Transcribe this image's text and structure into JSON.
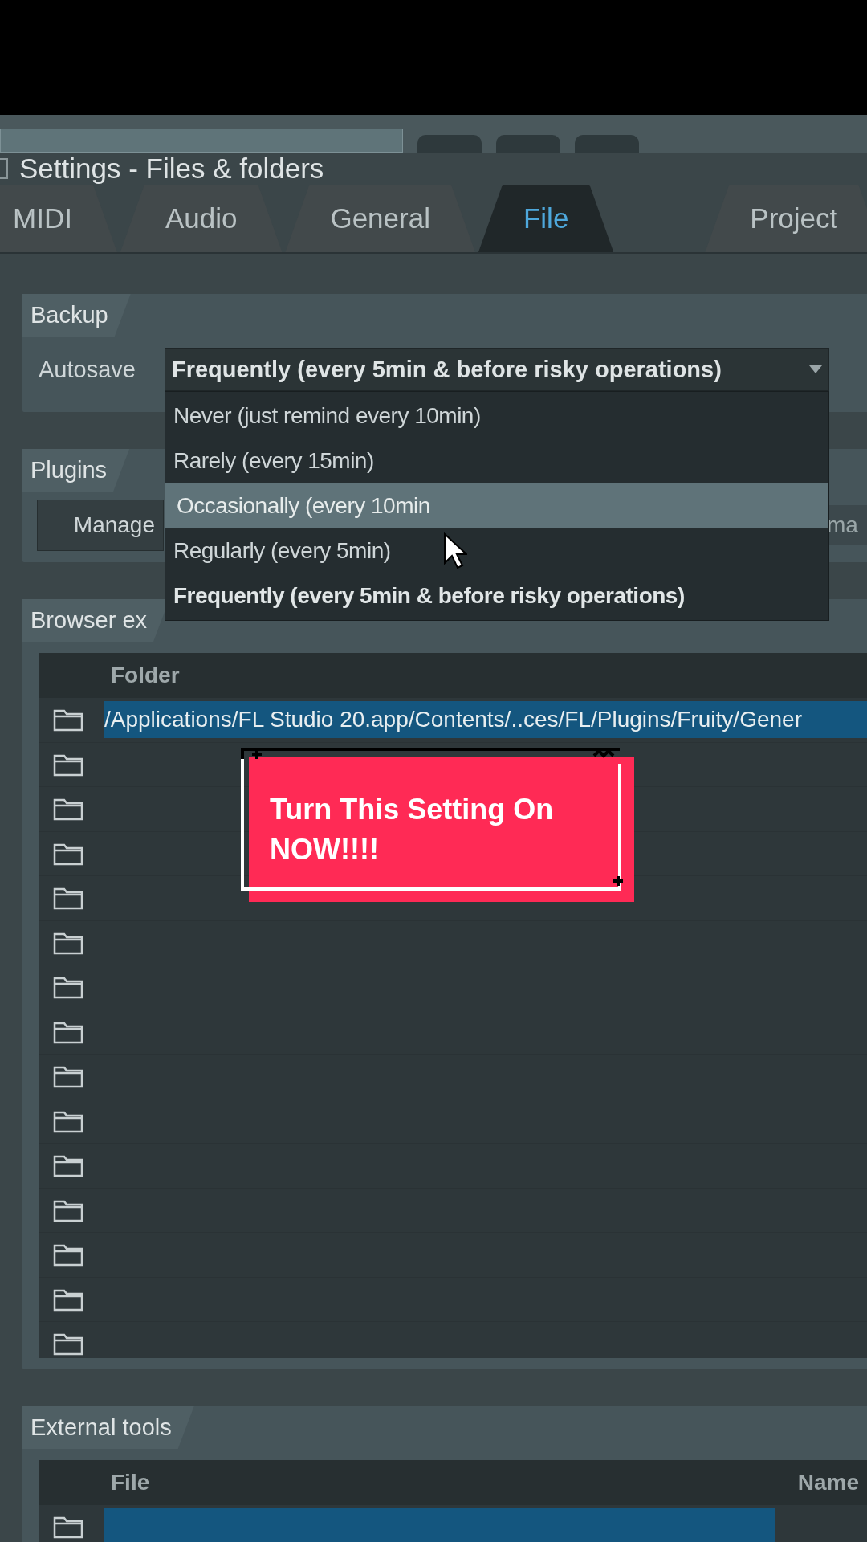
{
  "window": {
    "title": "Settings - Files & folders"
  },
  "tabs": [
    {
      "label": "MIDI",
      "selected": false
    },
    {
      "label": "Audio",
      "selected": false
    },
    {
      "label": "General",
      "selected": false
    },
    {
      "label": "File",
      "selected": true
    },
    {
      "label": "Project",
      "selected": false
    }
  ],
  "backup": {
    "heading": "Backup",
    "autosave": {
      "label": "Autosave",
      "value": "Frequently (every 5min & before risky operations)",
      "expanded": true,
      "options": [
        {
          "label": "Never (just remind every 10min)",
          "selected": false,
          "highlighted": false
        },
        {
          "label": "Rarely (every 15min)",
          "selected": false,
          "highlighted": false
        },
        {
          "label": "Occasionally (every 10min",
          "selected": false,
          "highlighted": true
        },
        {
          "label": "Regularly (every 5min)",
          "selected": false,
          "highlighted": false
        },
        {
          "label": "Frequently (every 5min & before risky operations)",
          "selected": true,
          "highlighted": false
        }
      ]
    }
  },
  "plugins": {
    "heading": "Plugins",
    "manage_button": "Manage",
    "path_field": "ma"
  },
  "browser_folders": {
    "heading": "Browser ex",
    "column": "Folder",
    "rows": [
      {
        "path": "/Applications/FL Studio 20.app/Contents/..ces/FL/Plugins/Fruity/Gener",
        "selected": true
      },
      {
        "selected": false
      },
      {
        "selected": false
      },
      {
        "selected": false
      },
      {
        "selected": false
      },
      {
        "selected": false
      },
      {
        "selected": false
      },
      {
        "selected": false
      },
      {
        "selected": false
      },
      {
        "selected": false
      },
      {
        "selected": false
      },
      {
        "selected": false
      },
      {
        "selected": false
      },
      {
        "selected": false
      },
      {
        "selected": false
      }
    ]
  },
  "caption": {
    "text": "Turn This Setting On NOW!!!!"
  },
  "external_tools": {
    "heading": "External tools",
    "columns": [
      "File",
      "Name"
    ],
    "rows": [
      {
        "selected": true
      }
    ]
  }
}
